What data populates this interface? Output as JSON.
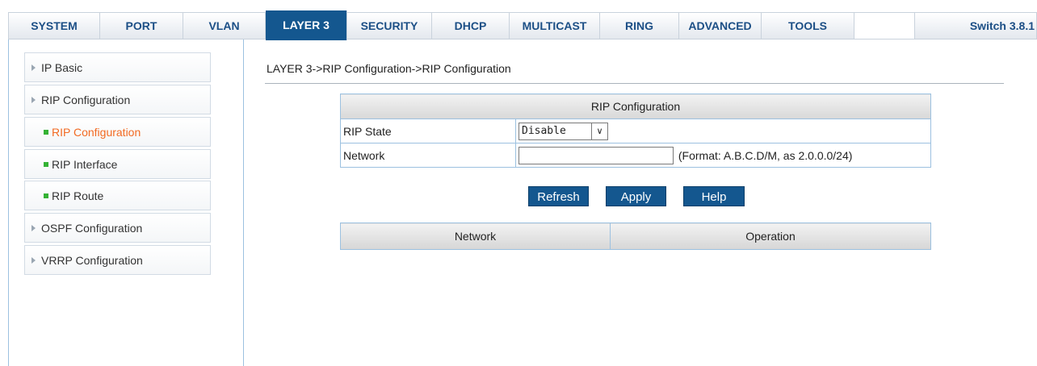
{
  "topnav": {
    "tabs": [
      "SYSTEM",
      "PORT",
      "VLAN",
      "LAYER 3",
      "SECURITY",
      "DHCP",
      "MULTICAST",
      "RING",
      "ADVANCED",
      "TOOLS"
    ],
    "active_tab": "LAYER 3",
    "version_label": "Switch 3.8.1"
  },
  "sidebar": {
    "items": [
      {
        "label": "IP Basic",
        "type": "section"
      },
      {
        "label": "RIP Configuration",
        "type": "section"
      },
      {
        "label": "RIP Configuration",
        "type": "sub",
        "current": true
      },
      {
        "label": "RIP Interface",
        "type": "sub"
      },
      {
        "label": "RIP Route",
        "type": "sub"
      },
      {
        "label": "OSPF Configuration",
        "type": "section"
      },
      {
        "label": "VRRP Configuration",
        "type": "section"
      }
    ]
  },
  "main": {
    "breadcrumb": "LAYER 3->RIP Configuration->RIP Configuration",
    "config_table": {
      "header": "RIP Configuration",
      "rip_state_label": "RIP State",
      "rip_state_value": "Disable",
      "network_label": "Network",
      "network_value": "",
      "network_hint": "(Format: A.B.C.D/M, as 2.0.0.0/24)"
    },
    "buttons": {
      "refresh": "Refresh",
      "apply": "Apply",
      "help": "Help"
    },
    "list_table": {
      "columns": [
        "Network",
        "Operation"
      ]
    }
  },
  "colors": {
    "accent": "#14578f",
    "current_item": "#f26a22",
    "sub_marker": "#34b234"
  }
}
